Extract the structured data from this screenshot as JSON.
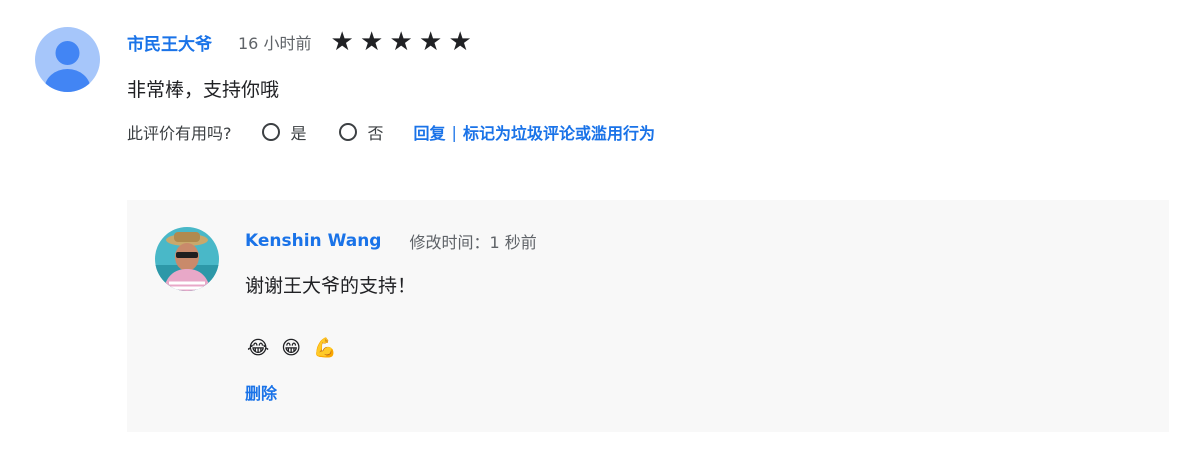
{
  "review": {
    "author": "市民王大爷",
    "time": "16 小时前",
    "rating": 5,
    "rating_max": 5,
    "star_glyph": "★",
    "text": "非常棒，支持你哦",
    "helpful_prompt": "此评价有用吗?",
    "helpful_yes": "是",
    "helpful_no": "否",
    "reply_link": "回复",
    "separator": "|",
    "report_link": "标记为垃圾评论或滥用行为"
  },
  "owner_reply": {
    "author": "Kenshin Wang",
    "time": "修改时间：1 秒前",
    "text": "谢谢王大爷的支持！",
    "emojis": [
      "😂",
      "😁",
      "💪"
    ],
    "delete_link": "删除"
  },
  "colors": {
    "link": "#1a73e8",
    "reply_background": "#f8f8f8",
    "default_avatar": "#a6c6fa",
    "default_avatar_figure": "#4285f4"
  }
}
